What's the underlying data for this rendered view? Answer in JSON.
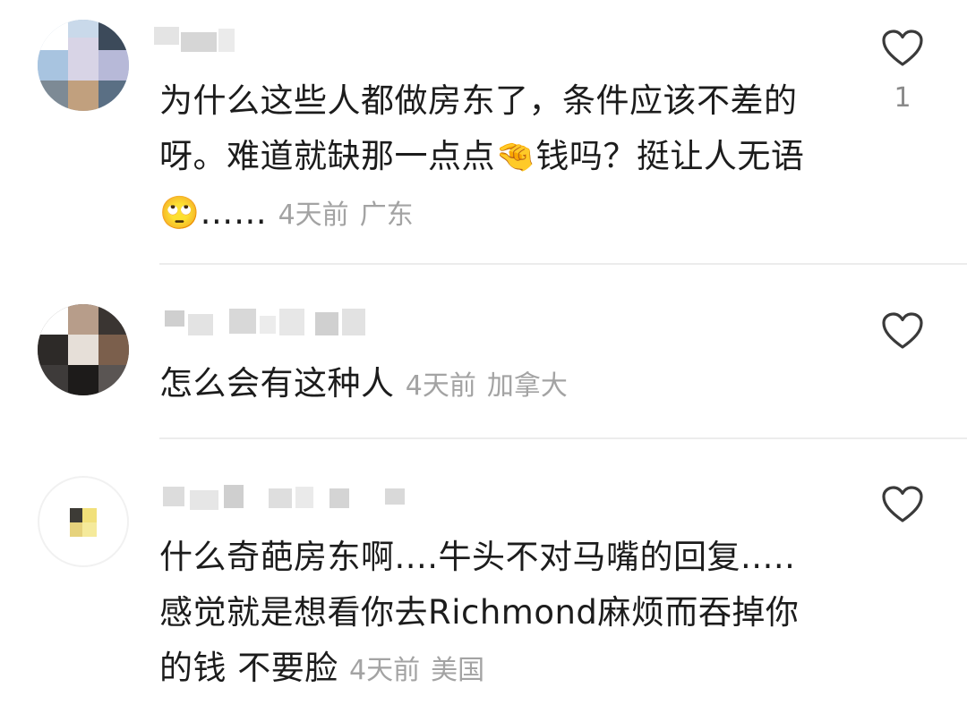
{
  "comments": [
    {
      "body_text": "为什么这些人都做房东了，条件应该不差的呀。难道就缺那一点点",
      "emoji1": "🤏",
      "body_text_2": "钱吗？挺让人无语",
      "emoji2": "🙄",
      "body_tail": "……",
      "time": "4天前",
      "location": "广东",
      "likes": "1",
      "like_icon": "heart-outline-icon"
    },
    {
      "body_text": "怎么会有这种人",
      "time": "4天前",
      "location": "加拿大",
      "like_icon": "heart-outline-icon"
    },
    {
      "body_text": "什么奇葩房东啊....牛头不对马嘴的回复.....感觉就是想看你去Richmond麻烦而吞掉你的钱 不要脸",
      "time": "4天前",
      "location": "美国",
      "like_icon": "heart-outline-icon"
    }
  ],
  "colors": {
    "text": "#1c1c1c",
    "meta": "#a3a3a3",
    "divider": "#ececec",
    "icon_stroke": "#3a3a3a"
  }
}
